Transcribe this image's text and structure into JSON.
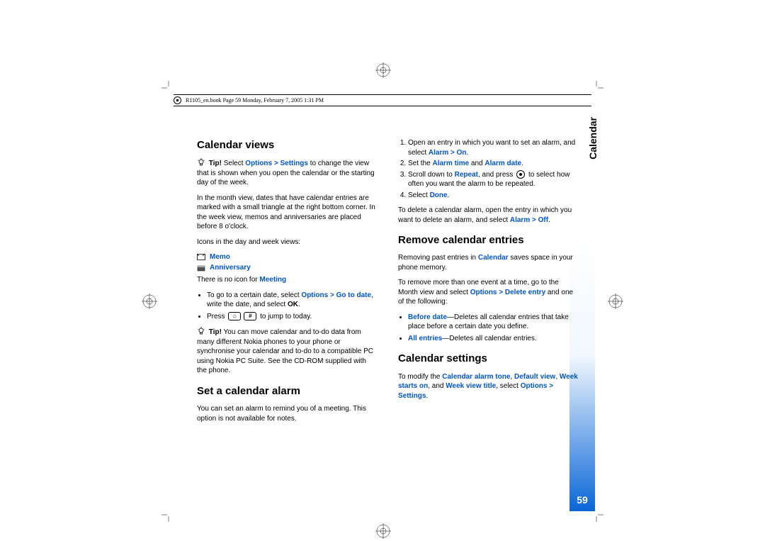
{
  "header": "R1105_en.book  Page 59  Monday, February 7, 2005  1:31 PM",
  "side_tab": "Calendar",
  "page_number": "59",
  "col1": {
    "h1": "Calendar views",
    "tip1_label": "Tip!",
    "tip1_a": " Select ",
    "tip1_b": "Options > Settings",
    "tip1_c": " to change the view that is shown when you open the calendar or the starting day of the week.",
    "p1": "In the month view, dates that have calendar entries are marked with a small triangle at the right bottom corner. In the week view, memos and anniversaries are placed before 8 o'clock.",
    "p2": "Icons in the day and week views:",
    "legend_memo": "Memo",
    "legend_anniv": "Anniversary",
    "p3_a": "There is no icon for ",
    "p3_b": "Meeting",
    "b1_a": "To go to a certain date, select ",
    "b1_b": "Options > Go to date",
    "b1_c": ", write the date, and select ",
    "b1_d": "OK",
    "b1_e": ".",
    "b2_a": "Press ",
    "b2_b": " to jump to today.",
    "tip2_label": "Tip!",
    "tip2_body": " You can move calendar and to-do data from many different Nokia phones to your phone or synchronise your calendar and to-do to a compatible PC using Nokia PC Suite. See the CD-ROM supplied with the phone.",
    "h2": "Set a calendar alarm",
    "p4": "You can set an alarm to remind you of a meeting. This option is not available for notes."
  },
  "col2": {
    "s1_a": "Open an entry in which you want to set an alarm, and select ",
    "s1_b": "Alarm > On",
    "s1_c": ".",
    "s2_a": "Set the ",
    "s2_b": "Alarm time",
    "s2_c": " and ",
    "s2_d": "Alarm date",
    "s2_e": ".",
    "s3_a": "Scroll down to ",
    "s3_b": "Repeat",
    "s3_c": ", and press ",
    "s3_d": " to select how often you want the alarm to be repeated.",
    "s4_a": "Select ",
    "s4_b": "Done",
    "s4_c": ".",
    "p5_a": "To delete a calendar alarm, open the entry in which you want to delete an alarm, and select ",
    "p5_b": "Alarm > Off",
    "p5_c": ".",
    "h3": "Remove calendar entries",
    "p6_a": "Removing past entries in ",
    "p6_b": "Calendar",
    "p6_c": " saves space in your phone memory.",
    "p7_a": "To remove more than one event at a time, go to the Month view and select ",
    "p7_b": "Options > Delete entry",
    "p7_c": " and one of the following:",
    "b3_a": "Before date",
    "b3_b": "—Deletes all calendar entries that take place before a certain date you define.",
    "b4_a": "All entries",
    "b4_b": "—Deletes all calendar entries.",
    "h4": "Calendar settings",
    "p8_a": "To modify the ",
    "p8_b": "Calendar alarm tone",
    "p8_c": ", ",
    "p8_d": "Default view",
    "p8_e": ", ",
    "p8_f": "Week starts on",
    "p8_g": ", and ",
    "p8_h": "Week view title",
    "p8_i": ", select ",
    "p8_j": "Options > Settings",
    "p8_k": "."
  }
}
